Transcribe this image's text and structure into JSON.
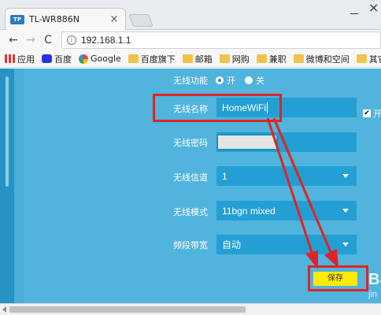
{
  "browser": {
    "tab_title": "TL-WR886N",
    "tab_favicon_text": "TP",
    "close_glyph": "×",
    "window_close_glyph": "×",
    "back_glyph": "←",
    "forward_glyph": "→",
    "reload_glyph": "C",
    "info_glyph": "i",
    "url": "192.168.1.1"
  },
  "bookmarks": [
    {
      "label": "应用",
      "icon": "apps-icon"
    },
    {
      "label": "百度",
      "icon": "baidu-icon"
    },
    {
      "label": "Google",
      "icon": "google-icon"
    },
    {
      "label": "百度旗下",
      "icon": "folder-icon"
    },
    {
      "label": "邮箱",
      "icon": "folder-icon"
    },
    {
      "label": "网购",
      "icon": "folder-icon"
    },
    {
      "label": "兼职",
      "icon": "folder-icon"
    },
    {
      "label": "微博和空间",
      "icon": "folder-icon"
    },
    {
      "label": "其它",
      "icon": "folder-icon"
    }
  ],
  "router": {
    "wireless_function": {
      "label": "无线功能",
      "on_label": "开",
      "off_label": "关",
      "selected": "on"
    },
    "ssid": {
      "label": "无线名称",
      "value": "HomeWiFi"
    },
    "password": {
      "label": "无线密码"
    },
    "channel": {
      "label": "无线信道",
      "value": "1"
    },
    "mode": {
      "label": "无线模式",
      "value": "11bgn mixed"
    },
    "bandwidth": {
      "label": "频段带宽",
      "value": "自动"
    },
    "side_checkbox": {
      "label": "开",
      "checked": true,
      "check_glyph": "✔"
    },
    "save_label": "保存"
  },
  "watermark": {
    "line1": "Ba",
    "line2": "jin"
  },
  "colors": {
    "page_bg": "#4aaed6",
    "field_bg": "#239fd4",
    "highlight": "#e02424",
    "save_bg": "#ffea00"
  }
}
